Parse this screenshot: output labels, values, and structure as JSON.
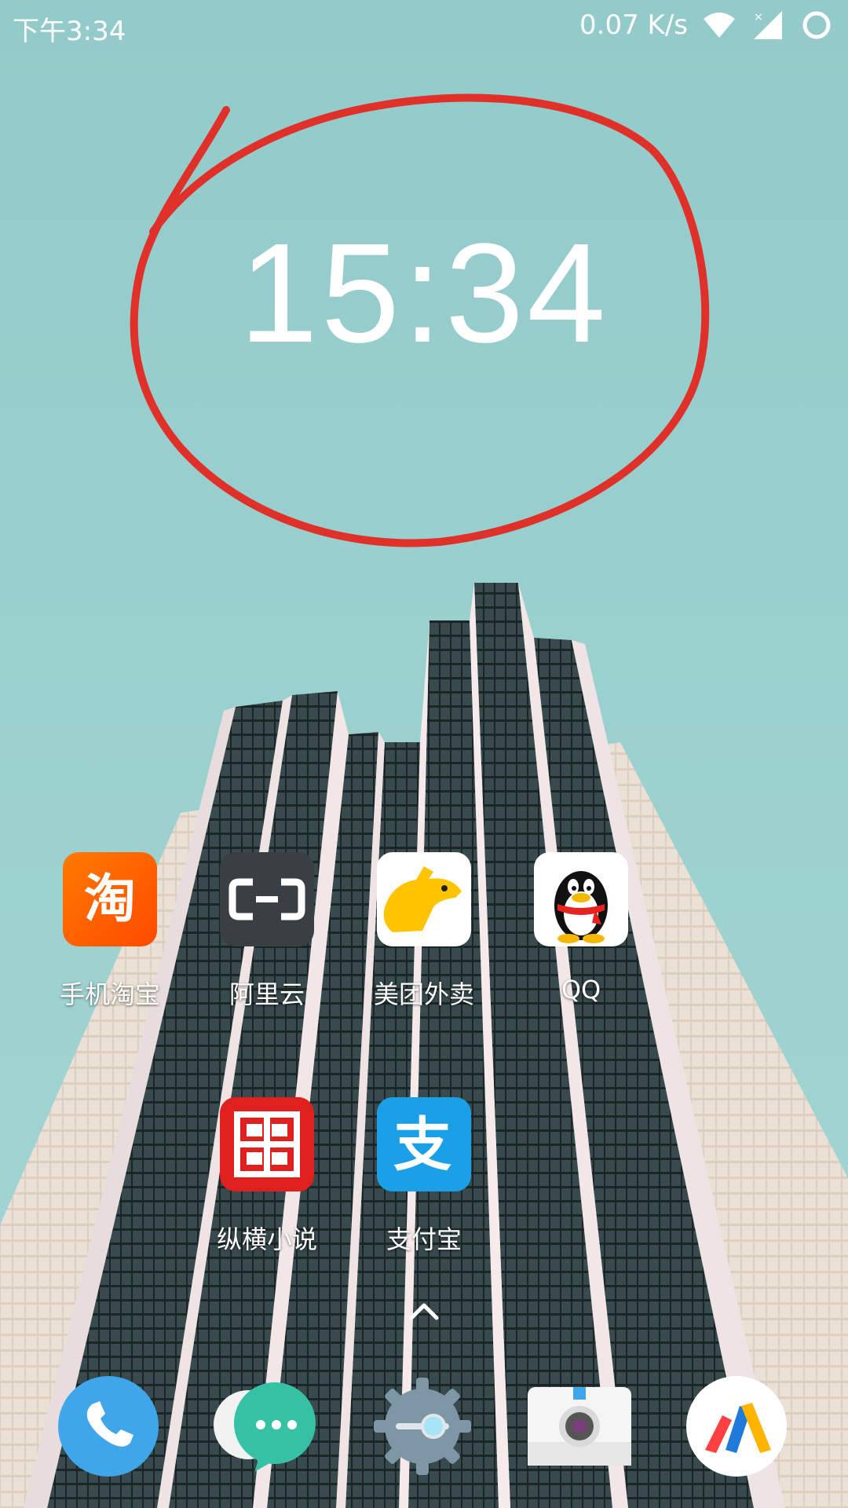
{
  "status_bar": {
    "time": "下午3:34",
    "net_speed": "0.07 K/s",
    "icons": [
      "wifi-icon",
      "signal-icon",
      "loading-ring-icon"
    ]
  },
  "clock": {
    "time": "15:34"
  },
  "apps": [
    {
      "label": "手机淘宝",
      "icon": "taobao-icon",
      "glyph": "淘"
    },
    {
      "label": "阿里云",
      "icon": "aliyun-icon",
      "glyph": "[-]"
    },
    {
      "label": "美团外卖",
      "icon": "meituan-waimai-icon",
      "glyph": ""
    },
    {
      "label": "QQ",
      "icon": "qq-penguin-icon",
      "glyph": ""
    },
    {
      "label": "纵横小说",
      "icon": "zongheng-icon",
      "glyph": ""
    },
    {
      "label": "支付宝",
      "icon": "alipay-icon",
      "glyph": "支"
    }
  ],
  "dock": [
    {
      "icon": "phone-icon"
    },
    {
      "icon": "messages-icon"
    },
    {
      "icon": "settings-icon"
    },
    {
      "icon": "camera-icon"
    },
    {
      "icon": "video-app-icon"
    }
  ],
  "colors": {
    "sky": "#9bd0cf",
    "annotation": "#e0302a",
    "taobao": "#ff5000",
    "aliyun": "#3a3f43",
    "meituan": "#ffc300",
    "zongheng": "#e01f1f",
    "alipay": "#1ba0e8"
  }
}
